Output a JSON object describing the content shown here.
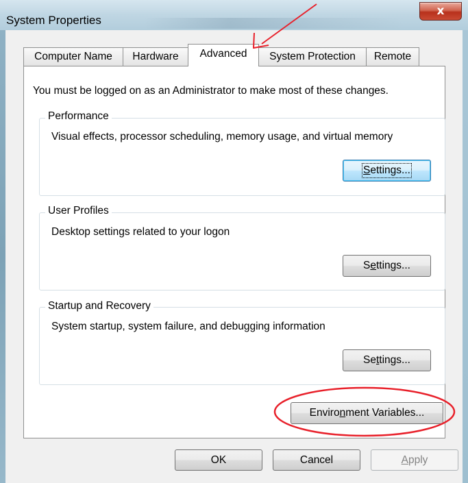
{
  "window": {
    "title": "System Properties",
    "close_glyph": "x"
  },
  "tabs": [
    {
      "label": "Computer Name",
      "active": false
    },
    {
      "label": "Hardware",
      "active": false
    },
    {
      "label": "Advanced",
      "active": true
    },
    {
      "label": "System Protection",
      "active": false
    },
    {
      "label": "Remote",
      "active": false
    }
  ],
  "advanced": {
    "intro": "You must be logged on as an Administrator to make most of these changes.",
    "performance": {
      "title": "Performance",
      "description": "Visual effects, processor scheduling, memory usage, and virtual memory",
      "button_pre": "",
      "button_mnemonic": "S",
      "button_post": "ettings..."
    },
    "user_profiles": {
      "title": "User Profiles",
      "description": "Desktop settings related to your logon",
      "button_pre": "S",
      "button_mnemonic": "e",
      "button_post": "ttings..."
    },
    "startup_recovery": {
      "title": "Startup and Recovery",
      "description": "System startup, system failure, and debugging information",
      "button_pre": "Se",
      "button_mnemonic": "t",
      "button_post": "tings..."
    },
    "env_vars": {
      "button_pre": "Enviro",
      "button_mnemonic": "n",
      "button_post": "ment Variables..."
    }
  },
  "footer": {
    "ok": "OK",
    "cancel": "Cancel",
    "apply_mnemonic": "A",
    "apply_post": "pply"
  },
  "colors": {
    "annotation": "#e8202a",
    "focus_blue": "#3c7fb1"
  }
}
